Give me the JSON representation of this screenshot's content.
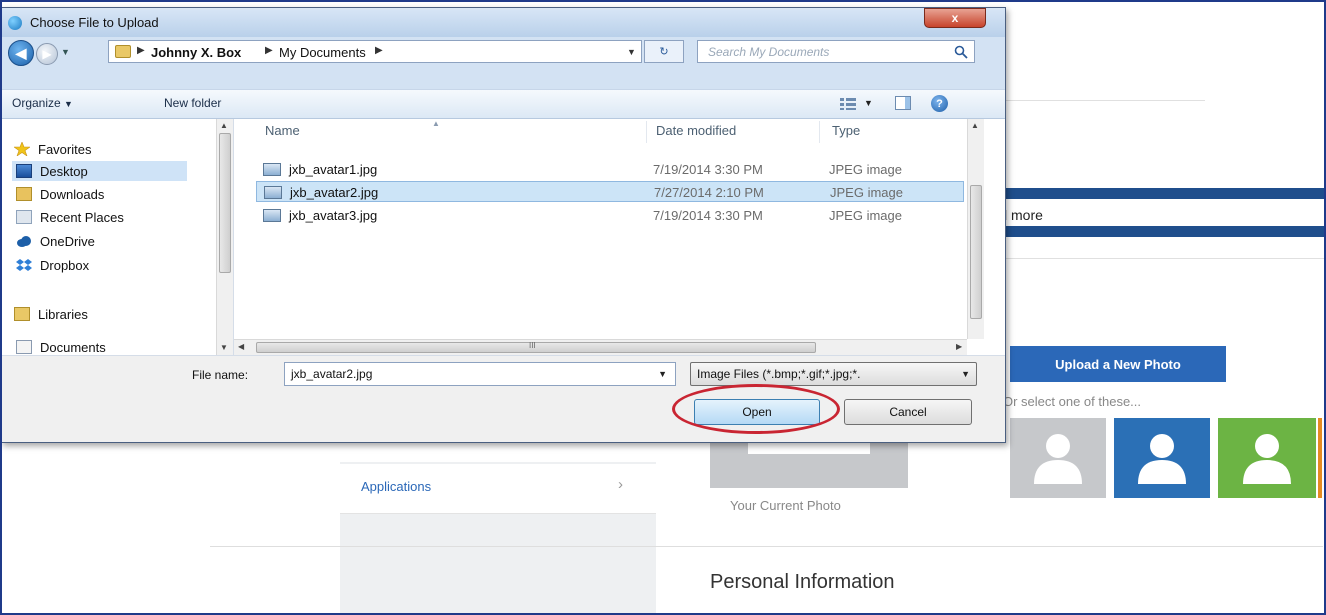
{
  "dialog": {
    "title": "Choose File to Upload",
    "close_label": "x",
    "breadcrumb": [
      "Johnny X. Box",
      "My Documents"
    ],
    "search_placeholder": "Search My Documents",
    "toolbar": {
      "organize_label": "Organize",
      "new_folder_label": "New folder"
    },
    "nav_items": [
      {
        "label": "Favorites",
        "icon": "star-icon"
      },
      {
        "label": "Desktop",
        "icon": "desktop-icon",
        "selected": true
      },
      {
        "label": "Downloads",
        "icon": "downloads-icon"
      },
      {
        "label": "Recent Places",
        "icon": "recent-places-icon"
      },
      {
        "label": "OneDrive",
        "icon": "cloud-icon"
      },
      {
        "label": "Dropbox",
        "icon": "dropbox-icon"
      },
      {
        "label": "Libraries",
        "icon": "libraries-icon"
      },
      {
        "label": "Documents",
        "icon": "documents-icon"
      }
    ],
    "columns": {
      "name": "Name",
      "date_modified": "Date modified",
      "type": "Type"
    },
    "files": [
      {
        "name": "jxb_avatar1.jpg",
        "date": "7/19/2014 3:30 PM",
        "type": "JPEG image",
        "selected": false
      },
      {
        "name": "jxb_avatar2.jpg",
        "date": "7/27/2014 2:10 PM",
        "type": "JPEG image",
        "selected": true
      },
      {
        "name": "jxb_avatar3.jpg",
        "date": "7/19/2014 3:30 PM",
        "type": "JPEG image",
        "selected": false
      }
    ],
    "file_name_label": "File name:",
    "file_name_value": "jxb_avatar2.jpg",
    "filter_value": "Image Files (*.bmp;*.gif;*.jpg;*.",
    "open_label": "Open",
    "cancel_label": "Cancel",
    "h_scroll_grip": "III"
  },
  "page": {
    "partial_link": "l more",
    "upload_button": "Upload a New Photo",
    "select_text": "Or select one of these...",
    "side_item": "Applications",
    "side_chevron": "›",
    "current_photo_label": "Your Current Photo",
    "personal_heading": "Personal Information"
  },
  "colors": {
    "accent": "#2b68b8",
    "annotation": "#c92532",
    "avatar_gray": "#c6c8cb",
    "avatar_blue": "#2b70b6",
    "avatar_green": "#6cb444"
  }
}
